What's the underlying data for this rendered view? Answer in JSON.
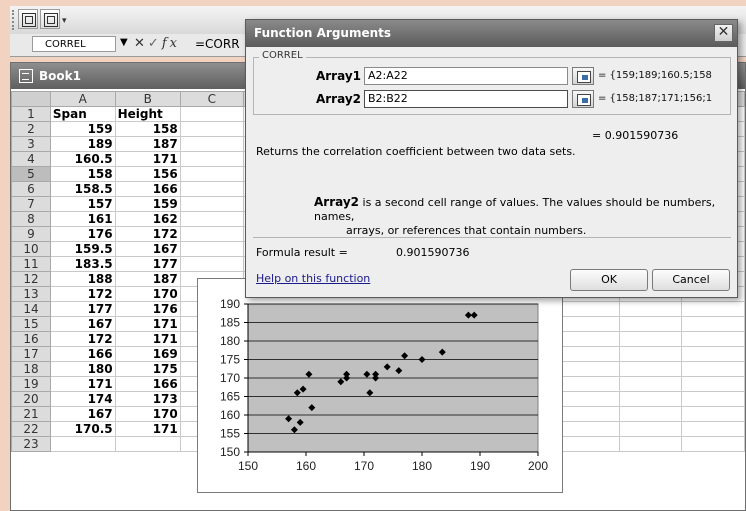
{
  "formula_bar": {
    "name_box": "CORREL",
    "formula": "=CORR"
  },
  "workbook": {
    "title": "Book1",
    "columns": [
      "A",
      "B",
      "C"
    ],
    "rows": [
      {
        "r": "1",
        "a": "Span",
        "b": "Height"
      },
      {
        "r": "2",
        "a": "159",
        "b": "158"
      },
      {
        "r": "3",
        "a": "189",
        "b": "187"
      },
      {
        "r": "4",
        "a": "160.5",
        "b": "171"
      },
      {
        "r": "5",
        "a": "158",
        "b": "156"
      },
      {
        "r": "6",
        "a": "158.5",
        "b": "166"
      },
      {
        "r": "7",
        "a": "157",
        "b": "159"
      },
      {
        "r": "8",
        "a": "161",
        "b": "162"
      },
      {
        "r": "9",
        "a": "176",
        "b": "172"
      },
      {
        "r": "10",
        "a": "159.5",
        "b": "167"
      },
      {
        "r": "11",
        "a": "183.5",
        "b": "177"
      },
      {
        "r": "12",
        "a": "188",
        "b": "187"
      },
      {
        "r": "13",
        "a": "172",
        "b": "170"
      },
      {
        "r": "14",
        "a": "177",
        "b": "176"
      },
      {
        "r": "15",
        "a": "167",
        "b": "171"
      },
      {
        "r": "16",
        "a": "172",
        "b": "171"
      },
      {
        "r": "17",
        "a": "166",
        "b": "169"
      },
      {
        "r": "18",
        "a": "180",
        "b": "175"
      },
      {
        "r": "19",
        "a": "171",
        "b": "166"
      },
      {
        "r": "20",
        "a": "174",
        "b": "173"
      },
      {
        "r": "21",
        "a": "167",
        "b": "170"
      },
      {
        "r": "22",
        "a": "170.5",
        "b": "171"
      },
      {
        "r": "23",
        "a": "",
        "b": ""
      }
    ]
  },
  "dialog": {
    "title": "Function Arguments",
    "function_name": "CORREL",
    "args": [
      {
        "label": "Array1",
        "value": "A2:A22",
        "evaluated": "= {159;189;160.5;158"
      },
      {
        "label": "Array2",
        "value": "B2:B22",
        "evaluated": "= {158;187;171;156;1"
      }
    ],
    "result_line": "= 0.901590736",
    "description": "Returns the correlation coefficient between two data sets.",
    "arg_help_name": "Array2",
    "arg_help_line1": " is a second cell range of values. The values should be numbers, names,",
    "arg_help_line2": "arrays, or references that contain numbers.",
    "formula_result_label": "Formula result =",
    "formula_result_value": "0.901590736",
    "help_link": "Help on this function",
    "ok_label": "OK",
    "cancel_label": "Cancel",
    "close_icon": "close-icon"
  },
  "chart_data": {
    "type": "scatter",
    "title": "",
    "xlabel": "",
    "ylabel": "",
    "xlim": [
      150,
      200
    ],
    "ylim": [
      150,
      190
    ],
    "xticks": [
      "150",
      "160",
      "170",
      "180",
      "190",
      "200"
    ],
    "yticks": [
      "150",
      "155",
      "160",
      "165",
      "170",
      "175",
      "180",
      "185",
      "190"
    ],
    "grid": true,
    "legend": "none",
    "plot_area_color": "#c0c0c0",
    "marker_color": "#000000",
    "points": [
      [
        159,
        158
      ],
      [
        189,
        187
      ],
      [
        160.5,
        171
      ],
      [
        158,
        156
      ],
      [
        158.5,
        166
      ],
      [
        157,
        159
      ],
      [
        161,
        162
      ],
      [
        176,
        172
      ],
      [
        159.5,
        167
      ],
      [
        183.5,
        177
      ],
      [
        188,
        187
      ],
      [
        172,
        170
      ],
      [
        177,
        176
      ],
      [
        167,
        171
      ],
      [
        172,
        171
      ],
      [
        166,
        169
      ],
      [
        180,
        175
      ],
      [
        171,
        166
      ],
      [
        174,
        173
      ],
      [
        167,
        170
      ],
      [
        170.5,
        171
      ]
    ]
  }
}
